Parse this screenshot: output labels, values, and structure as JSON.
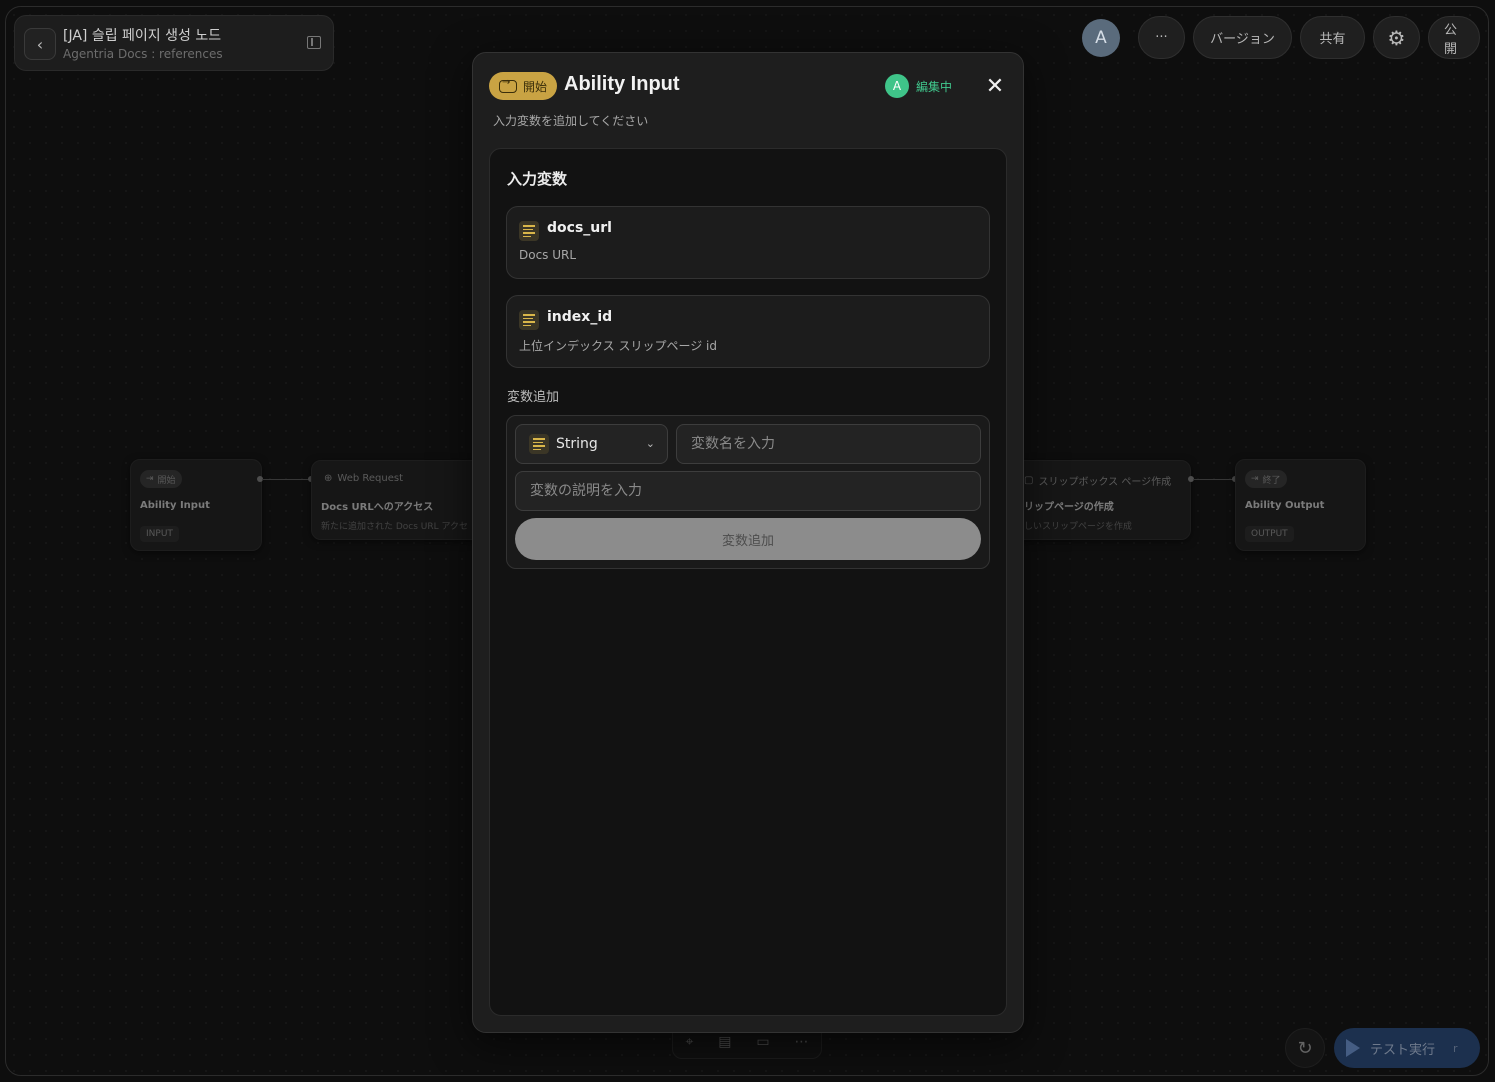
{
  "project": {
    "title": "[JA] 슬립 페이지 생성 노드",
    "subtitle": "Agentria Docs : references"
  },
  "toolbar": {
    "avatar_letter": "A",
    "more_label": "···",
    "version_label": "バージョン",
    "share_label": "共有",
    "publish_label": "公開"
  },
  "nodes": {
    "input": {
      "chip": "開始",
      "title": "Ability Input",
      "tag": "INPUT"
    },
    "web": {
      "head": "Web Request",
      "title": "Docs URLへのアクセス",
      "desc": "新たに追加された Docs URL アクセ"
    },
    "slip": {
      "head": "スリップボックス ページ作成",
      "title": "リップページの作成",
      "desc": "しいスリップページを作成"
    },
    "output": {
      "chip": "終了",
      "title": "Ability Output",
      "tag": "OUTPUT"
    }
  },
  "bottom": {
    "run_label": "テスト実行",
    "run_key": "r"
  },
  "modal": {
    "badge_label": "開始",
    "title": "Ability Input",
    "editing_avatar": "A",
    "editing_label": "編集中",
    "close_label": "✕",
    "subtitle": "入力変数を追加してください",
    "section_title": "入力変数",
    "variables": [
      {
        "name": "docs_url",
        "description": "Docs URL"
      },
      {
        "name": "index_id",
        "description": "上位インデックス スリップページ id"
      }
    ],
    "add_section_label": "変数追加",
    "type_select_value": "String",
    "name_placeholder": "変数名を入力",
    "desc_placeholder": "変数の説明を入力",
    "add_button_label": "変数追加"
  },
  "colors": {
    "badge": "#c9a343",
    "editing": "#41c98e",
    "run_button": "#2b4a78"
  }
}
